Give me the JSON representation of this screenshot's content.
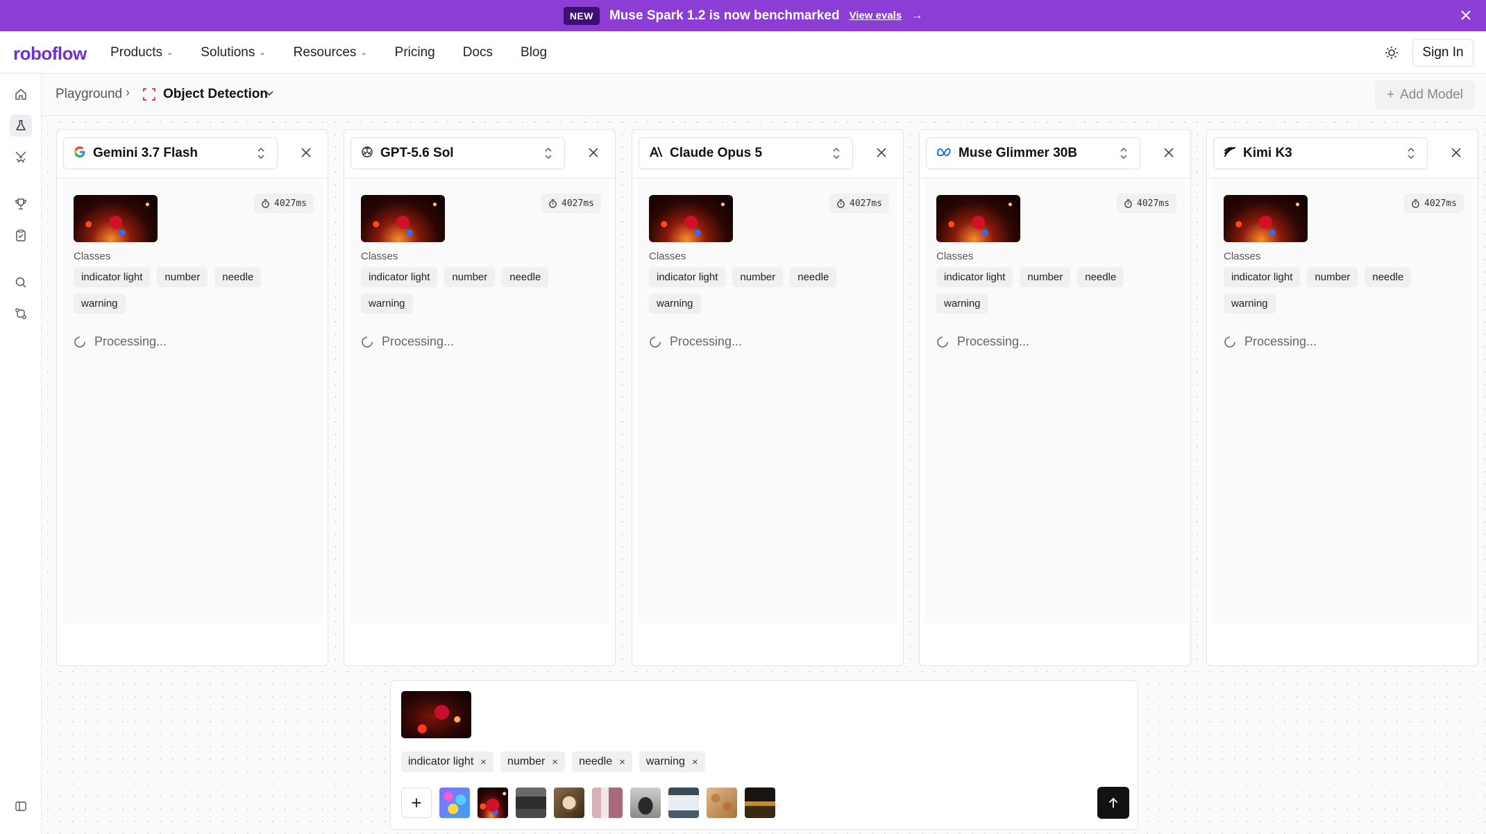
{
  "banner": {
    "badge": "NEW",
    "message": "Muse Spark 1.2 is now benchmarked",
    "link": "View evals",
    "arrow": "→"
  },
  "nav": {
    "logo": "roboflow",
    "items": [
      {
        "label": "Products",
        "dropdown": true
      },
      {
        "label": "Solutions",
        "dropdown": true
      },
      {
        "label": "Resources",
        "dropdown": true
      },
      {
        "label": "Pricing",
        "dropdown": false
      },
      {
        "label": "Docs",
        "dropdown": false
      },
      {
        "label": "Blog",
        "dropdown": false
      }
    ],
    "sign_in": "Sign In"
  },
  "breadcrumb": {
    "root": "Playground",
    "task": "Object Detection",
    "add_model": "Add Model"
  },
  "panels": [
    {
      "model": "Gemini 3.7 Flash",
      "icon": "google-icon",
      "latency": "4027ms",
      "classes_label": "Classes",
      "classes": [
        "indicator light",
        "number",
        "needle",
        "warning"
      ],
      "status": "Processing..."
    },
    {
      "model": "GPT-5.6 Sol",
      "icon": "openai-icon",
      "latency": "4027ms",
      "classes_label": "Classes",
      "classes": [
        "indicator light",
        "number",
        "needle",
        "warning"
      ],
      "status": "Processing..."
    },
    {
      "model": "Claude Opus 5",
      "icon": "anthropic-icon",
      "latency": "4027ms",
      "classes_label": "Classes",
      "classes": [
        "indicator light",
        "number",
        "needle",
        "warning"
      ],
      "status": "Processing..."
    },
    {
      "model": "Muse Glimmer 30B",
      "icon": "meta-icon",
      "latency": "4027ms",
      "classes_label": "Classes",
      "classes": [
        "indicator light",
        "number",
        "needle",
        "warning"
      ],
      "status": "Processing..."
    },
    {
      "model": "Kimi K3",
      "icon": "kimi-icon",
      "latency": "4027ms",
      "classes_label": "Classes",
      "classes": [
        "indicator light",
        "number",
        "needle",
        "warning"
      ],
      "status": "Processing..."
    }
  ],
  "composer": {
    "classes": [
      "indicator light",
      "number",
      "needle",
      "warning"
    ],
    "remove_glyph": "×",
    "add_glyph": "+",
    "samples": [
      "balloons",
      "dashboard",
      "machinery",
      "gauge",
      "shelf",
      "person",
      "whiteboard",
      "cookies",
      "sunset"
    ]
  },
  "colors": {
    "brand": "#6f2fd1",
    "banner_bg": "#8b3dd6",
    "badge_bg": "#3d0f74",
    "send_bg": "#111111"
  }
}
